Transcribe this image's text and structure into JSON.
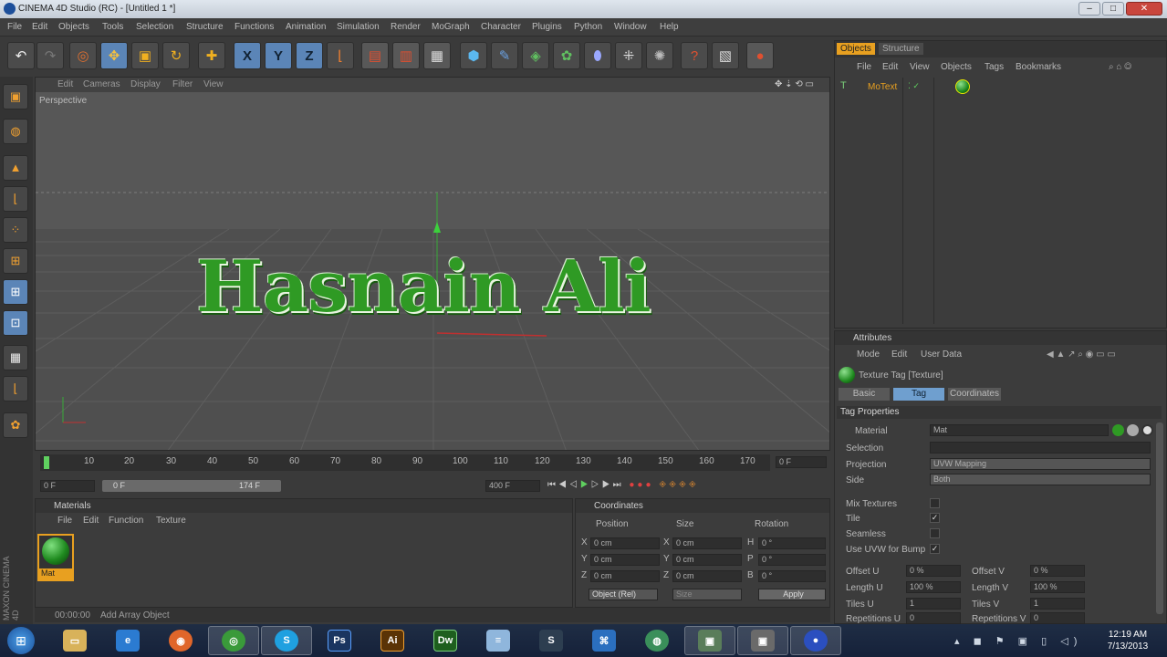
{
  "window": {
    "title": "CINEMA 4D Studio (RC) - [Untitled 1 *]",
    "minimize": "–",
    "maximize": "□",
    "close": "✕"
  },
  "menubar": [
    "File",
    "Edit",
    "Objects",
    "Tools",
    "Selection",
    "Structure",
    "Functions",
    "Animation",
    "Simulation",
    "Render",
    "MoGraph",
    "Character",
    "Plugins",
    "Python",
    "Window",
    "Help"
  ],
  "toolbar": {
    "axis_x": "X",
    "axis_y": "Y",
    "axis_z": "Z"
  },
  "viewport": {
    "menu": [
      "Edit",
      "Cameras",
      "Display",
      "Filter",
      "View"
    ],
    "label": "Perspective",
    "text3d": "Hasnain Ali"
  },
  "timeline": {
    "ticks": [
      "0",
      "10",
      "20",
      "30",
      "40",
      "50",
      "60",
      "70",
      "80",
      "90",
      "100",
      "110",
      "120",
      "130",
      "140",
      "150",
      "160",
      "170"
    ],
    "frame_current": "0 F",
    "frame_start": "0 F",
    "range_start": "0 F",
    "range_end": "174 F",
    "frame_end": "400 F"
  },
  "materials": {
    "title": "Materials",
    "menu": [
      "File",
      "Edit",
      "Function",
      "Texture"
    ],
    "item_name": "Mat"
  },
  "coordinates": {
    "title": "Coordinates",
    "headers": [
      "Position",
      "Size",
      "Rotation"
    ],
    "rows": [
      {
        "axis": "X",
        "pos": "0 cm",
        "size": "0 cm",
        "rlabel": "H",
        "rot": "0 °"
      },
      {
        "axis": "Y",
        "pos": "0 cm",
        "size": "0 cm",
        "rlabel": "P",
        "rot": "0 °"
      },
      {
        "axis": "Z",
        "pos": "0 cm",
        "size": "0 cm",
        "rlabel": "B",
        "rot": "0 °"
      }
    ],
    "mode": "Object (Rel)",
    "size_mode": "Size",
    "apply": "Apply"
  },
  "objects": {
    "tabs": [
      "Objects",
      "Structure"
    ],
    "menu": [
      "File",
      "Edit",
      "View",
      "Objects",
      "Tags",
      "Bookmarks"
    ],
    "item": "MoText"
  },
  "attributes": {
    "title": "Attributes",
    "menu": [
      "Mode",
      "Edit",
      "User Data"
    ],
    "tag_title": "Texture Tag [Texture]",
    "tabs": [
      "Basic",
      "Tag",
      "Coordinates"
    ],
    "section": "Tag Properties",
    "material_label": "Material",
    "material_value": "Mat",
    "selection_label": "Selection",
    "projection_label": "Projection",
    "projection_value": "UVW Mapping",
    "side_label": "Side",
    "side_value": "Both",
    "mix_label": "Mix Textures",
    "tile_label": "Tile",
    "seamless_label": "Seamless",
    "uvw_bump_label": "Use UVW for Bump",
    "offset_u_label": "Offset U",
    "offset_u": "0 %",
    "offset_v_label": "Offset V",
    "offset_v": "0 %",
    "length_u_label": "Length U",
    "length_u": "100 %",
    "length_v_label": "Length V",
    "length_v": "100 %",
    "tiles_u_label": "Tiles U",
    "tiles_u": "1",
    "tiles_v_label": "Tiles V",
    "tiles_v": "1",
    "rep_u_label": "Repetitions U",
    "rep_u": "0",
    "rep_v_label": "Repetitions V",
    "rep_v": "0"
  },
  "statusbar": {
    "time": "00:00:00",
    "message": "Add Array Object"
  },
  "brand": [
    "MAXON",
    "CINEMA 4D"
  ],
  "taskbar": {
    "clock_time": "12:19 AM",
    "clock_date": "7/13/2013",
    "apps": [
      {
        "name": "start",
        "glyph": "⊞",
        "color": "#2c6fbf"
      },
      {
        "name": "explorer",
        "glyph": "▭",
        "color": "#d8b25a"
      },
      {
        "name": "ie",
        "glyph": "e",
        "color": "#2b7bd1"
      },
      {
        "name": "firefox",
        "glyph": "◉",
        "color": "#e0662a"
      },
      {
        "name": "chrome",
        "glyph": "◎",
        "color": "#3a9a3a"
      },
      {
        "name": "skype",
        "glyph": "S",
        "color": "#1fa0e0"
      },
      {
        "name": "photoshop",
        "glyph": "Ps",
        "color": "#1a3560"
      },
      {
        "name": "illustrator",
        "glyph": "Ai",
        "color": "#5a3306"
      },
      {
        "name": "dreamweaver",
        "glyph": "Dw",
        "color": "#1e5f1e"
      },
      {
        "name": "notepad",
        "glyph": "≡",
        "color": "#8fb6dc"
      },
      {
        "name": "app-s",
        "glyph": "S",
        "color": "#2d3e50"
      },
      {
        "name": "network",
        "glyph": "⌘",
        "color": "#2b6fbf"
      },
      {
        "name": "globe",
        "glyph": "◍",
        "color": "#3a8f5a"
      },
      {
        "name": "cinema4d-1",
        "glyph": "▣",
        "color": "#5a7d5a"
      },
      {
        "name": "cinema4d-2",
        "glyph": "▣",
        "color": "#6a6a6a"
      },
      {
        "name": "cinema4d-3",
        "glyph": "●",
        "color": "#2b4fbf"
      }
    ]
  }
}
